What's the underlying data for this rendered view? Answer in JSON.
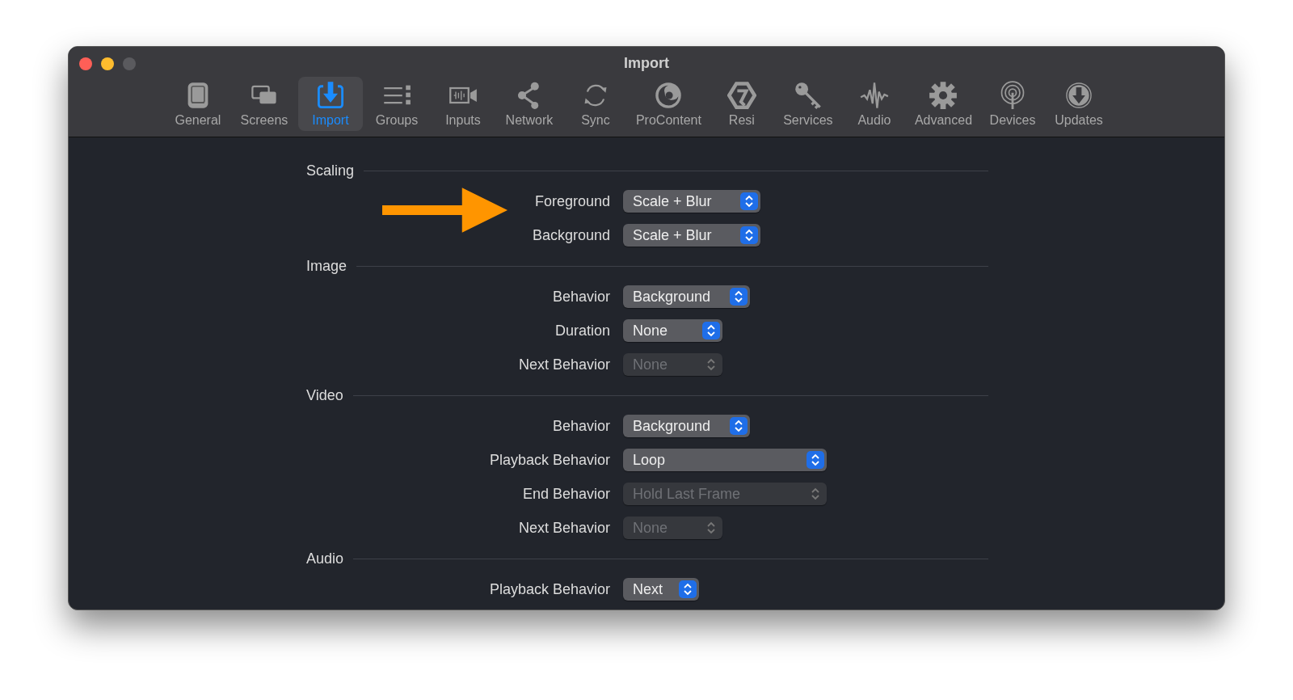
{
  "window": {
    "title": "Import"
  },
  "toolbar": [
    {
      "label": "General",
      "selected": false
    },
    {
      "label": "Screens",
      "selected": false
    },
    {
      "label": "Import",
      "selected": true
    },
    {
      "label": "Groups",
      "selected": false
    },
    {
      "label": "Inputs",
      "selected": false
    },
    {
      "label": "Network",
      "selected": false
    },
    {
      "label": "Sync",
      "selected": false
    },
    {
      "label": "ProContent",
      "selected": false
    },
    {
      "label": "Resi",
      "selected": false
    },
    {
      "label": "Services",
      "selected": false
    },
    {
      "label": "Audio",
      "selected": false
    },
    {
      "label": "Advanced",
      "selected": false
    },
    {
      "label": "Devices",
      "selected": false
    },
    {
      "label": "Updates",
      "selected": false
    }
  ],
  "sections": [
    {
      "title": "Scaling",
      "rows": [
        {
          "label": "Foreground",
          "value": "Scale + Blur",
          "disabled": false
        },
        {
          "label": "Background",
          "value": "Scale + Blur",
          "disabled": false
        }
      ]
    },
    {
      "title": "Image",
      "rows": [
        {
          "label": "Behavior",
          "value": "Background",
          "disabled": false
        },
        {
          "label": "Duration",
          "value": "None",
          "disabled": false
        },
        {
          "label": "Next Behavior",
          "value": "None",
          "disabled": true
        }
      ]
    },
    {
      "title": "Video",
      "rows": [
        {
          "label": "Behavior",
          "value": "Background",
          "disabled": false
        },
        {
          "label": "Playback Behavior",
          "value": "Loop",
          "disabled": false
        },
        {
          "label": "End Behavior",
          "value": "Hold Last Frame",
          "disabled": true
        },
        {
          "label": "Next Behavior",
          "value": "None",
          "disabled": true
        }
      ]
    },
    {
      "title": "Audio",
      "rows": [
        {
          "label": "Playback Behavior",
          "value": "Next",
          "disabled": false
        }
      ]
    }
  ]
}
